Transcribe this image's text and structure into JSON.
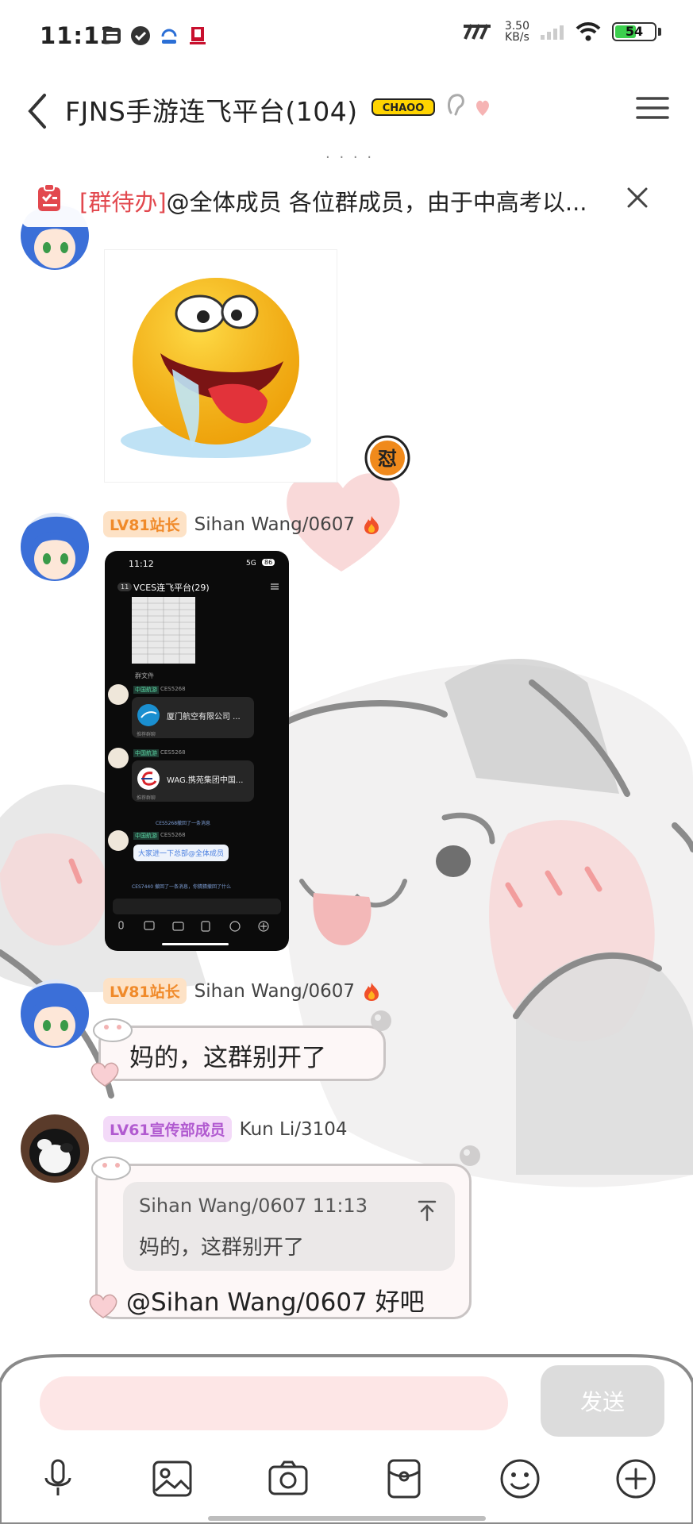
{
  "status_bar": {
    "time": "11:13",
    "network_speed_value": "3.50",
    "network_speed_unit": "KB/s",
    "carrier_logo": "777",
    "battery_level": "54",
    "battery_fraction": 0.54
  },
  "header": {
    "title": "FJNS手游连飞平台(104)",
    "badge_text": "CHAOO"
  },
  "notice": {
    "tag": "[群待办]",
    "text": "@全体成员 各位群成员，由于中高考以..."
  },
  "messages": {
    "m2": {
      "level": "LV81站长",
      "sender": "Sihan Wang/0607"
    },
    "m3": {
      "level": "LV81站长",
      "sender": "Sihan Wang/0607",
      "text": "妈的，这群别开了"
    },
    "m4": {
      "level": "LV61宣传部成员",
      "sender": "Kun Li/3104",
      "quote_meta": "Sihan Wang/0607 11:13",
      "quote_text": "妈的，这群别开了",
      "text": "@Sihan Wang/0607 好吧"
    }
  },
  "inner_screenshot": {
    "time": "11:12",
    "signal": "5G",
    "battery": "86",
    "back_count": "11",
    "title": "VCES连飞平台(29)",
    "group_file_label": "群文件",
    "tag1": "中国航游",
    "user1": "CES5268",
    "card1_title": "厦门航空有限公司 ...",
    "card1_sub": "推荐群聊",
    "tag2": "中国航游",
    "user2": "CES5268",
    "card2_title": "WAG.携苑集团中国...",
    "card2_sub": "推荐群聊",
    "recall_notice1": "CES5268撤回了一条消息",
    "tag3": "中国航游",
    "user3": "CES5268",
    "bubble_text": "大家进一下总部@全体成员",
    "recall_notice2": "CES7440 撤回了一条消息，你猜猜撤回了什么"
  },
  "sticker": {
    "gang_badge": "怼"
  },
  "input": {
    "placeholder": "",
    "send_label": "发送"
  },
  "icons": {
    "back": "back-arrow-icon",
    "menu": "hamburger-menu-icon",
    "notice": "clipboard-icon",
    "close": "close-icon",
    "voice": "microphone-icon",
    "image": "image-icon",
    "camera": "camera-icon",
    "red_packet": "red-packet-icon",
    "emoji": "emoji-icon",
    "plus": "plus-icon"
  },
  "colors": {
    "accent_red": "#e2484e",
    "level_orange": "#f08a2a",
    "level_purple": "#b15ad0",
    "input_pink": "#fde6e6",
    "send_disabled": "#dcdcdc"
  }
}
